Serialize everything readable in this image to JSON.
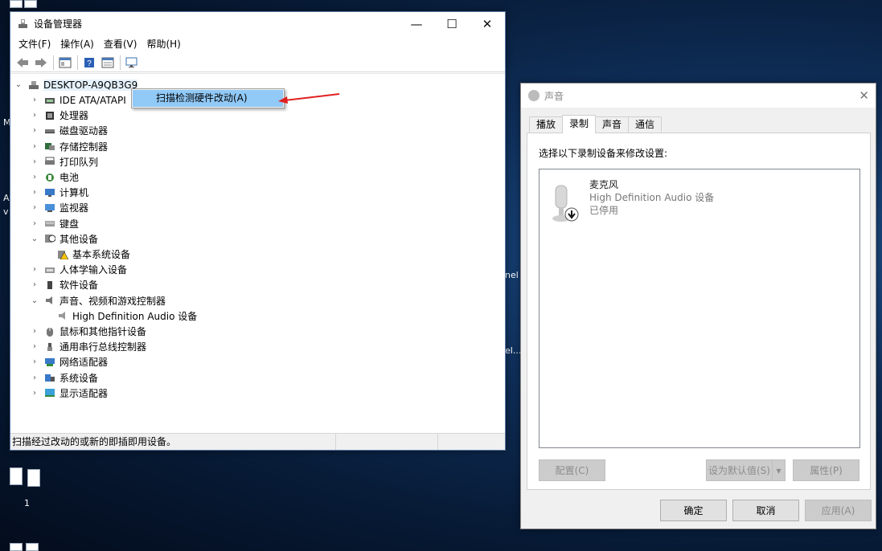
{
  "device_manager": {
    "title": "设备管理器",
    "menu": [
      "文件(F)",
      "操作(A)",
      "查看(V)",
      "帮助(H)"
    ],
    "root": "DESKTOP-A9QB3G9",
    "tree": [
      {
        "label": "IDE ATA/ATAPI",
        "expander": "›",
        "icon": "ide-controller-icon"
      },
      {
        "label": "处理器",
        "expander": "›",
        "icon": "processor-icon"
      },
      {
        "label": "磁盘驱动器",
        "expander": "›",
        "icon": "disk-drive-icon"
      },
      {
        "label": "存储控制器",
        "expander": "›",
        "icon": "storage-controller-icon"
      },
      {
        "label": "打印队列",
        "expander": "›",
        "icon": "printer-icon"
      },
      {
        "label": "电池",
        "expander": "›",
        "icon": "battery-icon"
      },
      {
        "label": "计算机",
        "expander": "›",
        "icon": "computer-icon"
      },
      {
        "label": "监视器",
        "expander": "›",
        "icon": "monitor-icon"
      },
      {
        "label": "键盘",
        "expander": "›",
        "icon": "keyboard-icon"
      },
      {
        "label": "其他设备",
        "expander": "⌄",
        "icon": "other-devices-icon"
      },
      {
        "label": "基本系统设备",
        "expander": "",
        "icon": "warning-device-icon",
        "child": true
      },
      {
        "label": "人体学输入设备",
        "expander": "›",
        "icon": "hid-icon"
      },
      {
        "label": "软件设备",
        "expander": "›",
        "icon": "software-device-icon"
      },
      {
        "label": "声音、视频和游戏控制器",
        "expander": "⌄",
        "icon": "speaker-icon"
      },
      {
        "label": "High Definition Audio 设备",
        "expander": "",
        "icon": "audio-device-icon",
        "child": true
      },
      {
        "label": "鼠标和其他指针设备",
        "expander": "›",
        "icon": "mouse-icon"
      },
      {
        "label": "通用串行总线控制器",
        "expander": "›",
        "icon": "usb-icon"
      },
      {
        "label": "网络适配器",
        "expander": "›",
        "icon": "network-adapter-icon"
      },
      {
        "label": "系统设备",
        "expander": "›",
        "icon": "system-device-icon"
      },
      {
        "label": "显示适配器",
        "expander": "›",
        "icon": "display-adapter-icon"
      }
    ],
    "context_menu_item": "扫描检测硬件改动(A)",
    "status": "扫描经过改动的或新的即插即用设备。"
  },
  "sound_dialog": {
    "title": "声音",
    "tabs": [
      "播放",
      "录制",
      "声音",
      "通信"
    ],
    "active_tab": "录制",
    "caption": "选择以下录制设备来修改设置:",
    "device": {
      "name": "麦克风",
      "description": "High Definition Audio 设备",
      "state": "已停用"
    },
    "buttons": {
      "configure": "配置(C)",
      "set_default": "设为默认值(S)",
      "properties": "属性(P)",
      "ok": "确定",
      "cancel": "取消",
      "apply": "应用(A)"
    }
  },
  "desktop": {
    "icon_label": "1",
    "partial_labels": [
      "M",
      "A",
      "v",
      "nel",
      "el..."
    ]
  },
  "colors": {
    "selection": "#91c9f7",
    "annotation_arrow": "#e02020"
  }
}
